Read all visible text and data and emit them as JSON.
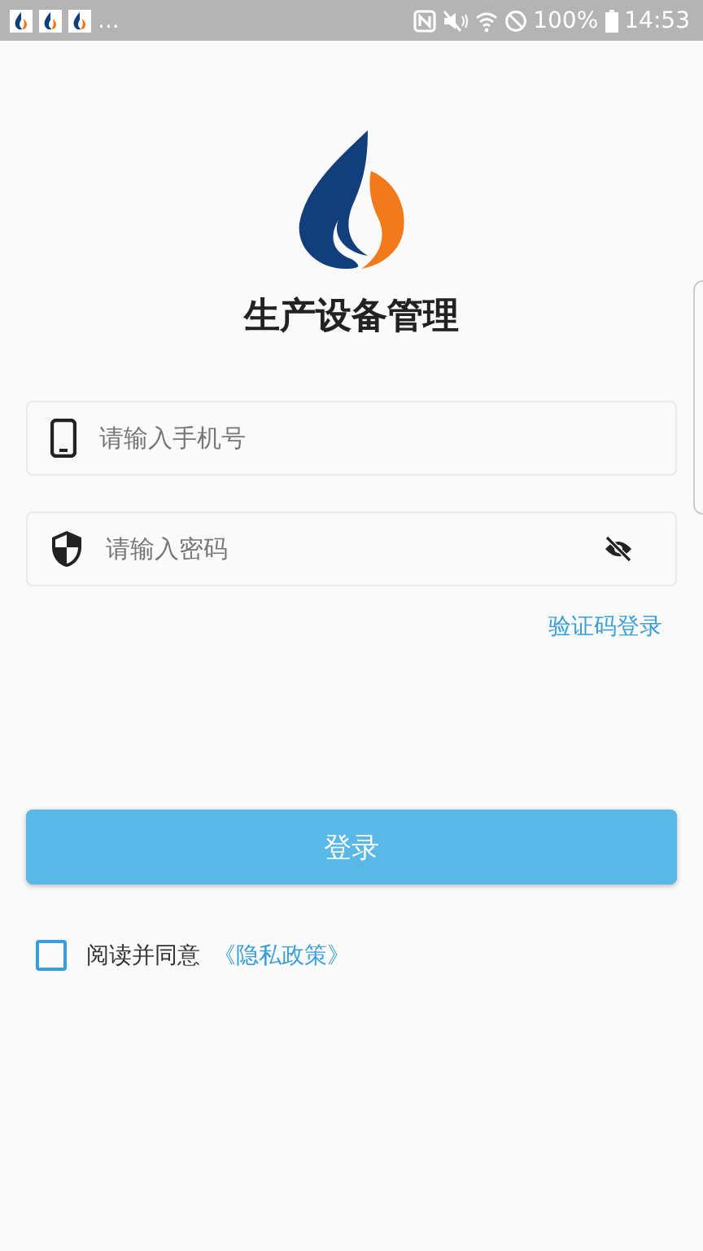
{
  "status_bar": {
    "overflow": "...",
    "battery": "100%",
    "time": "14:53"
  },
  "app_title": "生产设备管理",
  "phone_field": {
    "placeholder": "请输入手机号"
  },
  "password_field": {
    "placeholder": "请输入密码"
  },
  "code_login_link": "验证码登录",
  "login_button": "登录",
  "agreement": {
    "checked": false,
    "text": "阅读并同意",
    "link": "《隐私政策》"
  }
}
